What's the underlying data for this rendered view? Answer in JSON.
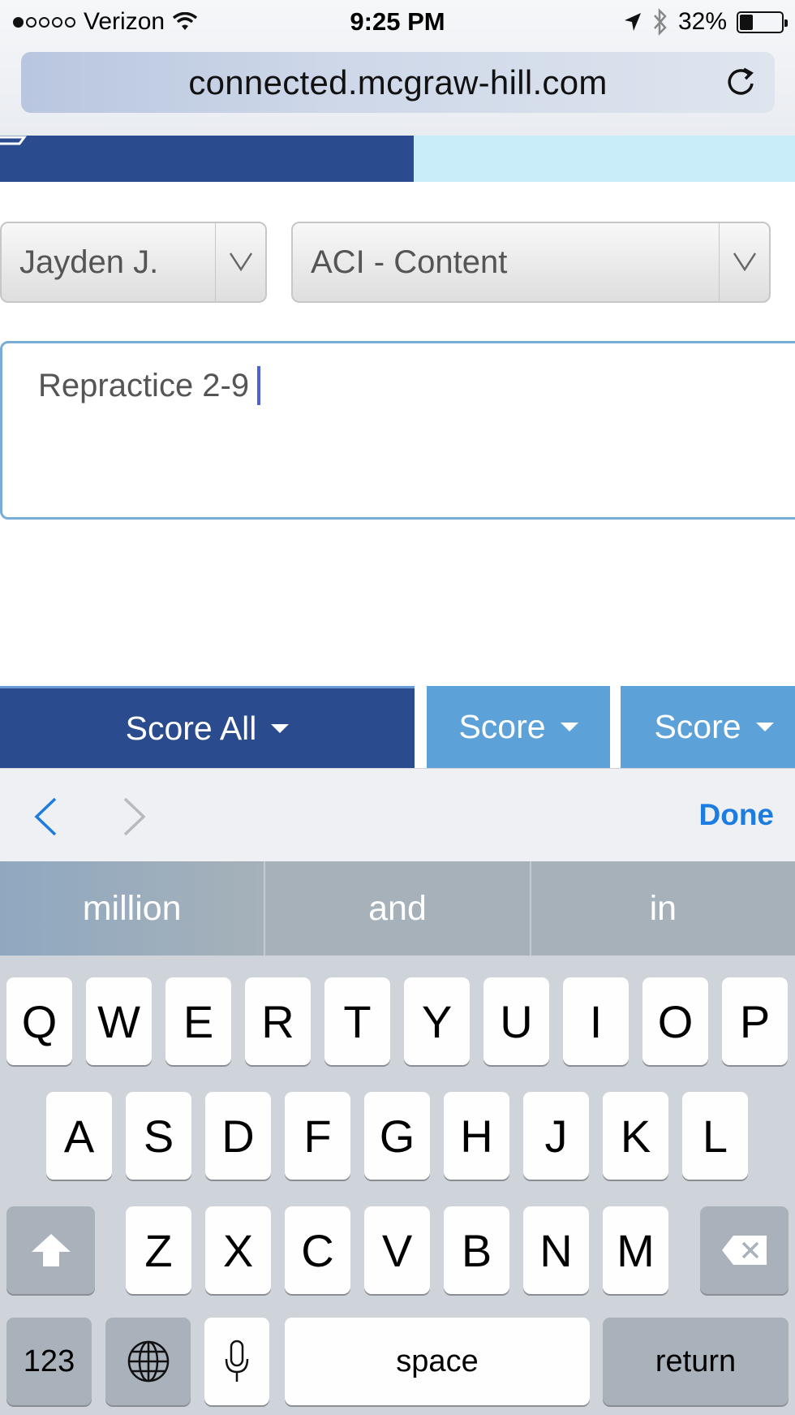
{
  "status_bar": {
    "carrier": "Verizon",
    "time": "9:25 PM",
    "battery": "32%",
    "battery_level": 0.32
  },
  "browser": {
    "url": "connected.mcgraw-hill.com"
  },
  "form": {
    "student_select": "Jayden J.",
    "category_select": "ACI - Content",
    "note_text": "Repractice 2-9"
  },
  "score_buttons": {
    "score_all": "Score All",
    "score_1": "Score",
    "score_2": "Score"
  },
  "accessory": {
    "done_label": "Done"
  },
  "predictive": [
    "million",
    "and",
    "in"
  ],
  "keyboard": {
    "row1": [
      "Q",
      "W",
      "E",
      "R",
      "T",
      "Y",
      "U",
      "I",
      "O",
      "P"
    ],
    "row2": [
      "A",
      "S",
      "D",
      "F",
      "G",
      "H",
      "J",
      "K",
      "L"
    ],
    "row3": [
      "Z",
      "X",
      "C",
      "V",
      "B",
      "N",
      "M"
    ],
    "numbers_key": "123",
    "space_key": "space",
    "return_key": "return"
  },
  "colors": {
    "header_dark": "#2a4b8d",
    "header_light": "#c9edf9",
    "score_blue": "#5ca1d8",
    "done_blue": "#1c7ce0"
  }
}
